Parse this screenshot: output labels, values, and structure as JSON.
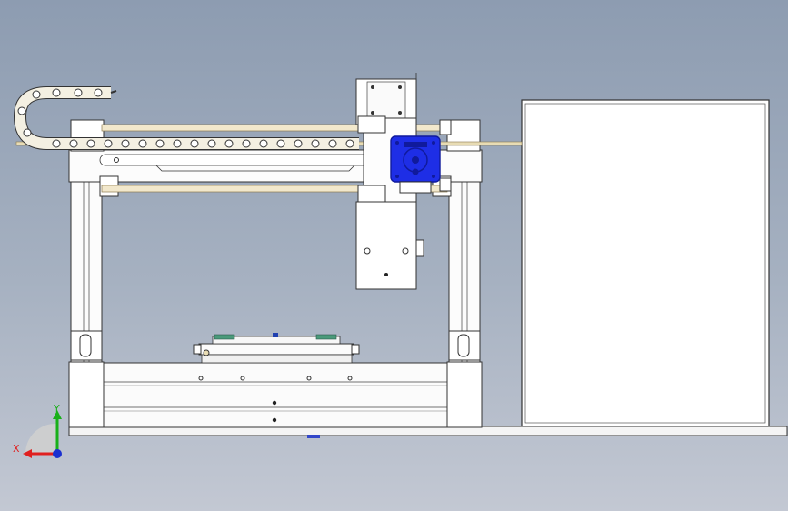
{
  "scene": {
    "view": "front",
    "background_top": "#8d9cb1",
    "background_bottom": "#c3c8d3",
    "part_fill": "#ffffff",
    "line_color": "#3a3a3a",
    "rail_color": "#e8dcb4",
    "motor_color": "#1e2ee6",
    "motor_dark": "#101a9c"
  },
  "drag_chain": {
    "link_count": 18
  },
  "triad": {
    "x_label": "X",
    "y_label": "Y",
    "x_color": "#e02020",
    "y_color": "#19b019",
    "z_color": "#1a2fd0"
  }
}
